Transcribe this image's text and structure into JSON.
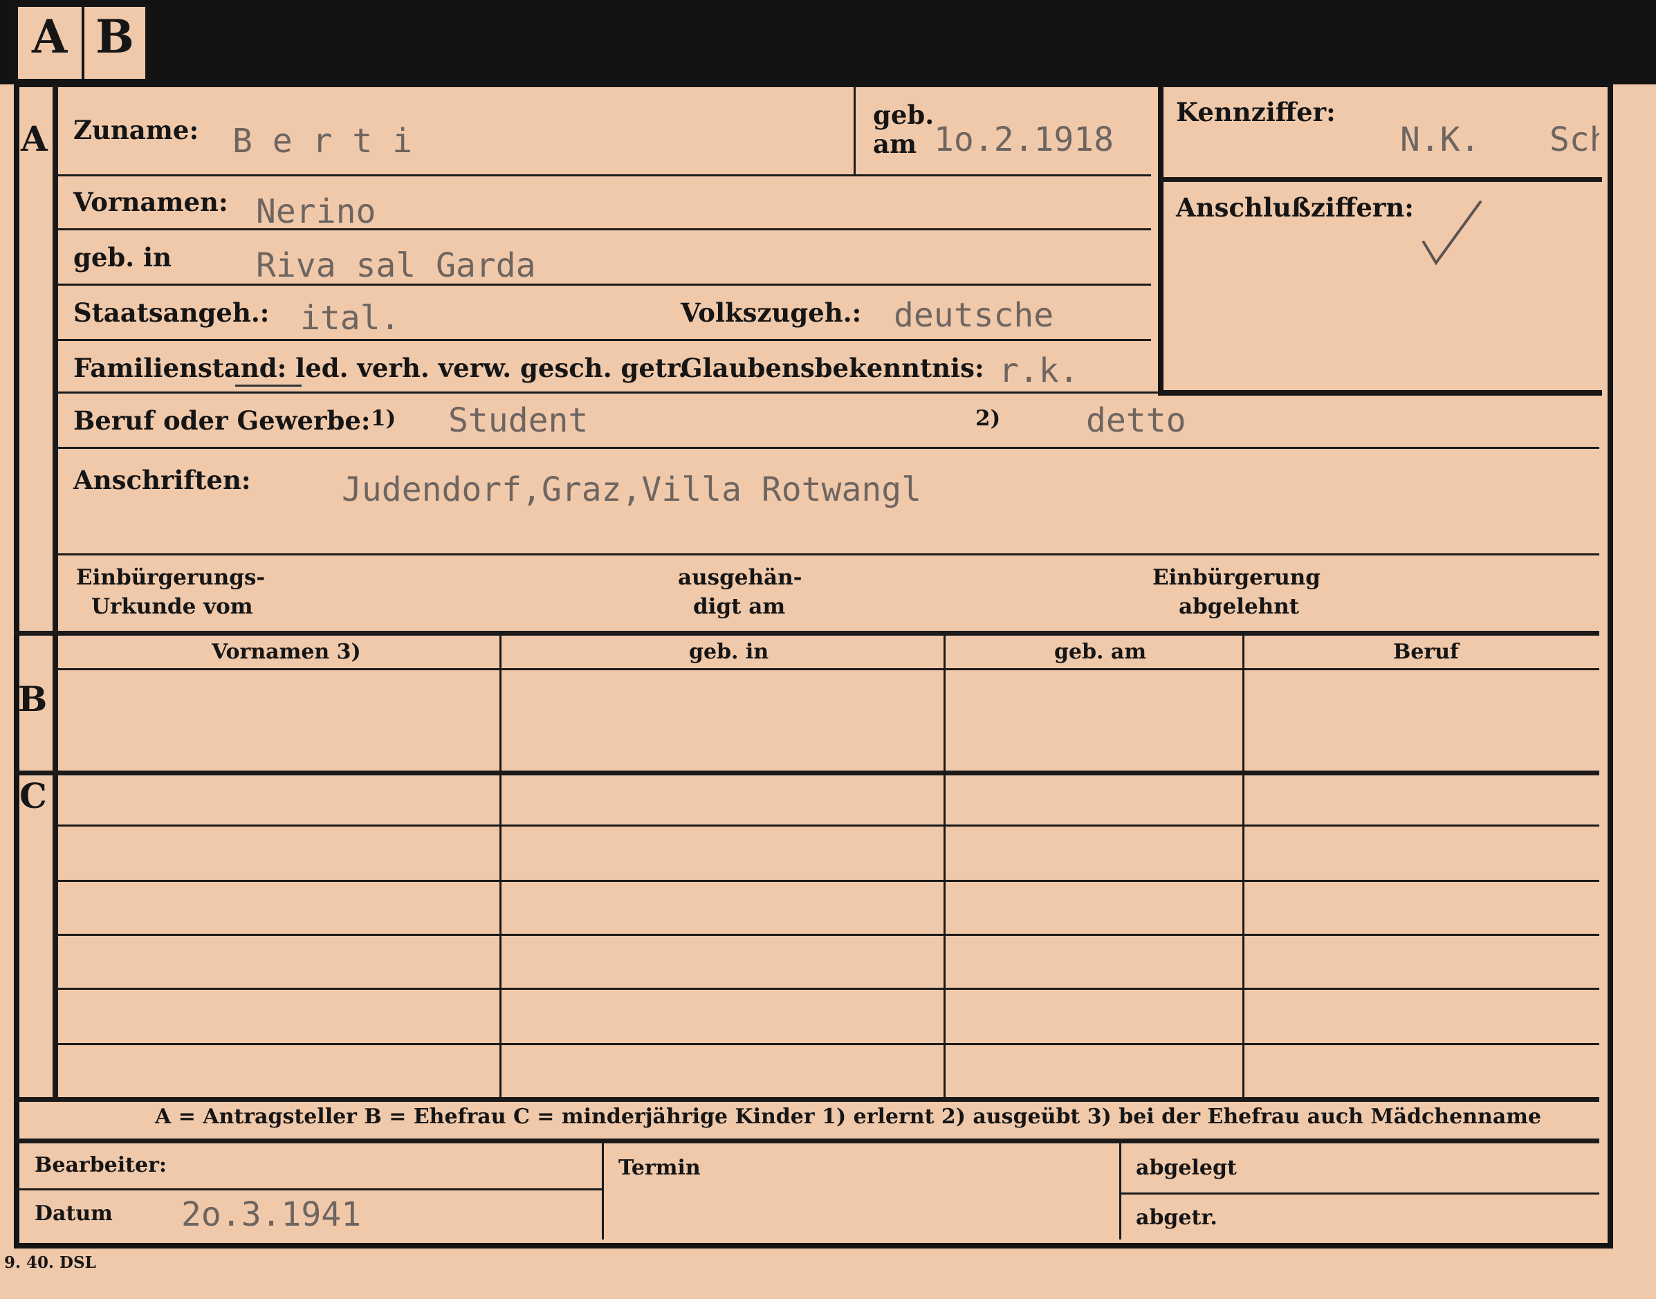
{
  "tabs": [
    "A",
    "B"
  ],
  "sections": {
    "a": "A",
    "b": "B",
    "c": "C"
  },
  "form": {
    "zuname_label": "Zuname:",
    "zuname_value": "B e r t i",
    "geb_label": "geb.",
    "am_label": "am",
    "geb_am_value": "1o.2.1918",
    "kennziffer_label": "Kennziffer:",
    "kennziffer_value": "N.K.",
    "kennziffer_value2": "Sch",
    "anschlussziffern_label": "Anschlußziffern:",
    "vornamen_label": "Vornamen:",
    "vornamen_value": "Nerino",
    "geb_in_label": "geb. in",
    "geb_in_value": "Riva sal Garda",
    "staatsangeh_label": "Staatsangeh.:",
    "staatsangeh_value": "ital.",
    "volkszugeh_label": "Volkszugeh.:",
    "volkszugeh_value": "deutsche",
    "familienstand_label": "Familienstand: led. verh. verw. gesch. getr.",
    "glaubens_label": "Glaubensbekenntnis:",
    "glaubens_value": "r.k.",
    "beruf_label": "Beruf oder Gewerbe:",
    "beruf_fn1": "1)",
    "beruf_value1": "Student",
    "beruf_fn2": "2)",
    "beruf_value2": "detto",
    "anschriften_label": "Anschriften:",
    "anschriften_value": "Judendorf,Graz,Villa  Rotwangl",
    "einbuergerung_urkunde_l1": "Einbürgerungs-",
    "einbuergerung_urkunde_l2": "Urkunde vom",
    "ausgehaendigt_l1": "ausgehän-",
    "ausgehaendigt_l2": "digt am",
    "einbuergerung_abgelehnt_l1": "Einbürgerung",
    "einbuergerung_abgelehnt_l2": "abgelehnt"
  },
  "table": {
    "headers": [
      "Vornamen 3)",
      "geb. in",
      "geb. am",
      "Beruf"
    ]
  },
  "legend": "A = Antragsteller   B = Ehefrau   C = minderjährige Kinder   1) erlernt   2) ausgeübt   3) bei der Ehefrau auch Mädchenname",
  "footer": {
    "bearbeiter_label": "Bearbeiter:",
    "datum_label": "Datum",
    "datum_value": "2o.3.1941",
    "termin_label": "Termin",
    "abgelegt_label": "abgelegt",
    "abgetr_label": "abgetr."
  },
  "print_code": "9. 40. DSL",
  "colors": {
    "paper": "#f0c9ab",
    "ink": "#151515",
    "typewriter": "#6e6560"
  }
}
